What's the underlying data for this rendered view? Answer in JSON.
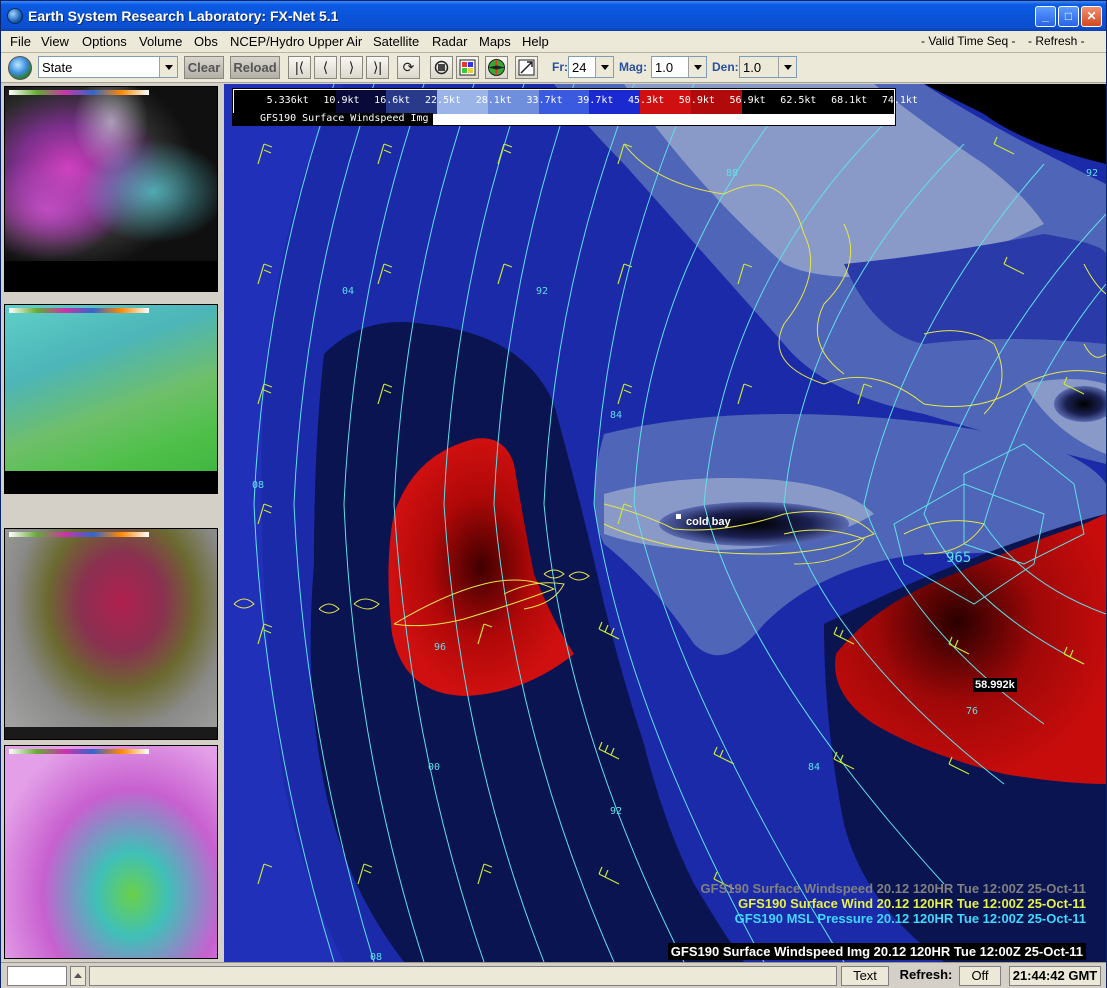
{
  "window": {
    "title": "Earth System Research Laboratory: FX-Net 5.1",
    "min": "_",
    "max": "□",
    "close": "✕"
  },
  "menu": {
    "items": [
      "File",
      "View",
      "Options",
      "Volume",
      "Obs",
      "NCEP/Hydro",
      "Upper Air",
      "Satellite",
      "Radar",
      "Maps",
      "Help"
    ],
    "valid_time_seq": "- Valid Time Seq -",
    "refresh": "- Refresh -"
  },
  "toolbar": {
    "region": "State",
    "clear": "Clear",
    "reload": "Reload",
    "first": "|⟨",
    "prev": "⟨",
    "next": "⟩",
    "last": "⟩|",
    "loop": "⟳",
    "fr_label": "Fr:",
    "fr_value": "24",
    "mag_label": "Mag:",
    "mag_value": "1.0",
    "den_label": "Den:",
    "den_value": "1.0"
  },
  "legend": {
    "caption": "GFS190 Surface Windspeed Img",
    "labels": [
      "5.336kt",
      "10.9kt",
      "16.6kt",
      "22.5kt",
      "28.1kt",
      "33.7kt",
      "39.7kt",
      "45.3kt",
      "50.9kt",
      "56.9kt",
      "62.5kt",
      "68.1kt",
      "74.1kt"
    ],
    "colors": [
      "#000000",
      "#000000",
      "#0a0a3a",
      "#2a3a8a",
      "#9ab4e8",
      "#6f8fdc",
      "#3a5ae0",
      "#1a2ad0",
      "#d01010",
      "#b00a0a",
      "#000000",
      "#000000",
      "#000000"
    ]
  },
  "map": {
    "captions": [
      "GFS190 Surface Windspeed  20.12 120HR Tue 12:00Z 25-Oct-11",
      "GFS190 Surface Wind  20.12 120HR Tue 12:00Z 25-Oct-11",
      "GFS190 MSL Pressure  20.12 120HR Tue 12:00Z 25-Oct-11",
      "GFS190 Surface Windspeed Img 20.12 120HR Tue 12:00Z 25-Oct-11"
    ],
    "station": "cold bay",
    "max_value": "58.992k",
    "isobar_labels": [
      "88",
      "92",
      "04",
      "92",
      "84",
      "08",
      "96",
      "00",
      "92",
      "84",
      "76",
      "965",
      "08"
    ],
    "colors": {
      "deep": "#0a1450",
      "mid": "#1a2aa0",
      "light": "#4a62c0",
      "pale": "#8a9ac8",
      "red": "#c80a0a",
      "isobar": "#5fe0e8",
      "coast": "#e6e64a"
    }
  },
  "status": {
    "input": "",
    "message": "",
    "text_button": "Text",
    "refresh_label": "Refresh:",
    "refresh_value": "Off",
    "time": "21:44:42 GMT"
  }
}
